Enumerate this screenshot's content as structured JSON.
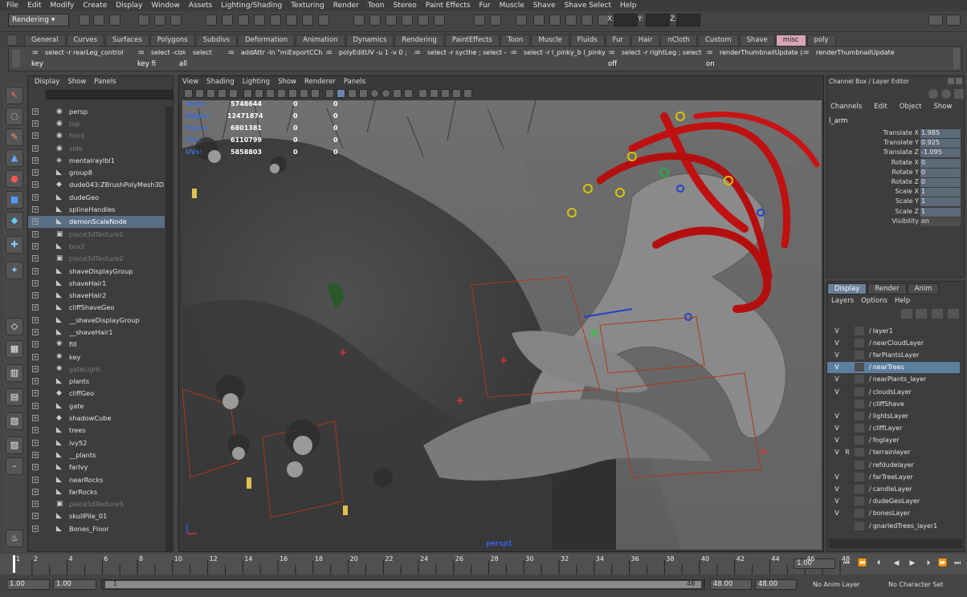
{
  "menubar": [
    "File",
    "Edit",
    "Modify",
    "Create",
    "Display",
    "Window",
    "Assets",
    "Lighting/Shading",
    "Texturing",
    "Render",
    "Toon",
    "Stereo",
    "Paint Effects",
    "Fur",
    "Muscle",
    "Shave",
    "Shave Select",
    "Help"
  ],
  "status": {
    "mode": "Rendering",
    "x_label": "X:",
    "y_label": "Y:",
    "z_label": "Z:"
  },
  "shelf_tabs": [
    "General",
    "Curves",
    "Surfaces",
    "Polygons",
    "Subdivs",
    "Deformation",
    "Animation",
    "Dynamics",
    "Rendering",
    "PaintEffects",
    "Toon",
    "Muscle",
    "Fluids",
    "Fur",
    "Hair",
    "nCloth",
    "Custom",
    "Shave",
    "misc",
    "poly"
  ],
  "shelf_active": "misc",
  "shelf_buttons": [
    {
      "label": "select -r rearLeg_control",
      "sub": "key"
    },
    {
      "label": "select -cl;",
      "sub": "key fi"
    },
    {
      "label": "select",
      "sub": "all"
    },
    {
      "label": "addAttr -ln \"miExportCCh",
      "sub": ""
    },
    {
      "label": "polyEditUV -u 1 -v 0 ;",
      "sub": ""
    },
    {
      "label": "select -r sycthe ; select -",
      "sub": ""
    },
    {
      "label": "select -r l_pinky_b l_pinky",
      "sub": ""
    },
    {
      "label": "select -r rightLeg ; select",
      "sub": "off"
    },
    {
      "label": "renderThumbnailUpdate (",
      "sub": "on"
    },
    {
      "label": "renderThumbnailUpdate",
      "sub": ""
    }
  ],
  "outliner": {
    "menu": [
      "Display",
      "Show",
      "Panels"
    ],
    "items": [
      {
        "name": "persp",
        "dim": false,
        "icon": "camera-icon"
      },
      {
        "name": "top",
        "dim": true,
        "icon": "camera-icon"
      },
      {
        "name": "front",
        "dim": true,
        "icon": "camera-icon"
      },
      {
        "name": "side",
        "dim": true,
        "icon": "camera-icon"
      },
      {
        "name": "mentalrayIbl1",
        "dim": false,
        "icon": "node-icon"
      },
      {
        "name": "group8",
        "dim": false,
        "icon": "transform-icon"
      },
      {
        "name": "dude043:ZBrushPolyMesh3D",
        "dim": false,
        "icon": "mesh-icon"
      },
      {
        "name": "dudeGeo",
        "dim": false,
        "icon": "transform-icon"
      },
      {
        "name": "splineHandles",
        "dim": false,
        "icon": "transform-icon"
      },
      {
        "name": "demonScaleNode",
        "dim": false,
        "icon": "transform-icon",
        "sel": true
      },
      {
        "name": "place3dTexture1",
        "dim": true,
        "icon": "texture-icon"
      },
      {
        "name": "box2",
        "dim": true,
        "icon": "transform-icon"
      },
      {
        "name": "place3dTexture2",
        "dim": true,
        "icon": "texture-icon"
      },
      {
        "name": "shaveDisplayGroup",
        "dim": false,
        "icon": "transform-icon"
      },
      {
        "name": "shaveHair1",
        "dim": false,
        "icon": "transform-icon"
      },
      {
        "name": "shaveHair2",
        "dim": false,
        "icon": "transform-icon"
      },
      {
        "name": "cliffShaveGeo",
        "dim": false,
        "icon": "transform-icon"
      },
      {
        "name": "__shaveDisplayGroup",
        "dim": false,
        "icon": "transform-icon"
      },
      {
        "name": "__shaveHair1",
        "dim": false,
        "icon": "transform-icon"
      },
      {
        "name": "fill",
        "dim": false,
        "icon": "light-icon"
      },
      {
        "name": "key",
        "dim": false,
        "icon": "light-icon"
      },
      {
        "name": "gateLight",
        "dim": true,
        "icon": "light-icon"
      },
      {
        "name": "plants",
        "dim": false,
        "icon": "transform-icon"
      },
      {
        "name": "cliffGeo",
        "dim": false,
        "icon": "mesh-icon"
      },
      {
        "name": "gate",
        "dim": false,
        "icon": "transform-icon"
      },
      {
        "name": "shadowCube",
        "dim": false,
        "icon": "mesh-icon"
      },
      {
        "name": "trees",
        "dim": false,
        "icon": "transform-icon"
      },
      {
        "name": "ivy52",
        "dim": false,
        "icon": "transform-icon"
      },
      {
        "name": "__plants",
        "dim": false,
        "icon": "transform-icon"
      },
      {
        "name": "farIvy",
        "dim": false,
        "icon": "transform-icon"
      },
      {
        "name": "nearRocks",
        "dim": false,
        "icon": "transform-icon"
      },
      {
        "name": "farRocks",
        "dim": false,
        "icon": "transform-icon"
      },
      {
        "name": "place3dTexture3",
        "dim": true,
        "icon": "texture-icon"
      },
      {
        "name": "skullPile_01",
        "dim": false,
        "icon": "transform-icon"
      },
      {
        "name": "Bones_Floor",
        "dim": false,
        "icon": "transform-icon"
      }
    ]
  },
  "viewport": {
    "menu": [
      "View",
      "Shading",
      "Lighting",
      "Show",
      "Renderer",
      "Panels"
    ],
    "hud": [
      {
        "label": "Verts:",
        "v1": "5748644",
        "v2": "0",
        "v3": "0"
      },
      {
        "label": "Edges:",
        "v1": "12471874",
        "v2": "0",
        "v3": "0"
      },
      {
        "label": "Faces:",
        "v1": "6801381",
        "v2": "0",
        "v3": "0"
      },
      {
        "label": "Tris:",
        "v1": "6110799",
        "v2": "0",
        "v3": "0"
      },
      {
        "label": "UVs:",
        "v1": "5858803",
        "v2": "0",
        "v3": "0"
      }
    ],
    "camera": "persp1"
  },
  "channelbox": {
    "title": "Channel Box / Layer Editor",
    "menu": [
      "Channels",
      "Edit",
      "Object",
      "Show"
    ],
    "object": "l_arm",
    "attrs": [
      {
        "name": "Translate X",
        "value": "1.985",
        "white": false
      },
      {
        "name": "Translate Y",
        "value": "0.925",
        "white": false
      },
      {
        "name": "Translate Z",
        "value": "-1.095",
        "white": false
      },
      {
        "name": "Rotate X",
        "value": "0",
        "white": false
      },
      {
        "name": "Rotate Y",
        "value": "0",
        "white": false
      },
      {
        "name": "Rotate Z",
        "value": "0",
        "white": false
      },
      {
        "name": "Scale X",
        "value": "1",
        "white": false
      },
      {
        "name": "Scale Y",
        "value": "1",
        "white": false
      },
      {
        "name": "Scale Z",
        "value": "1",
        "white": false
      },
      {
        "name": "Visibility",
        "value": "on",
        "white": true
      }
    ]
  },
  "layers": {
    "tabs": [
      "Display",
      "Render",
      "Anim"
    ],
    "menu": [
      "Layers",
      "Options",
      "Help"
    ],
    "items": [
      {
        "v": "V",
        "r": "",
        "name": "layer1"
      },
      {
        "v": "V",
        "r": "",
        "name": "nearCloudLayer"
      },
      {
        "v": "V",
        "r": "",
        "name": "farPlantsLayer"
      },
      {
        "v": "V",
        "r": "",
        "name": "nearTrees",
        "sel": true
      },
      {
        "v": "V",
        "r": "",
        "name": "nearPlants_layer"
      },
      {
        "v": "V",
        "r": "",
        "name": "cloudsLayer"
      },
      {
        "v": "",
        "r": "",
        "name": "cliffShave"
      },
      {
        "v": "V",
        "r": "",
        "name": "lightsLayer"
      },
      {
        "v": "V",
        "r": "",
        "name": "cliffLayer"
      },
      {
        "v": "V",
        "r": "",
        "name": "foglayer"
      },
      {
        "v": "V",
        "r": "R",
        "name": "terrainlayer"
      },
      {
        "v": "",
        "r": "",
        "name": "refdudelayer"
      },
      {
        "v": "V",
        "r": "",
        "name": "farTreeLayer"
      },
      {
        "v": "V",
        "r": "",
        "name": "candleLayer"
      },
      {
        "v": "V",
        "r": "",
        "name": "dudeGeoLayer"
      },
      {
        "v": "V",
        "r": "",
        "name": "bonesLayer"
      },
      {
        "v": "",
        "r": "",
        "name": "gnarledTrees_layer1"
      }
    ]
  },
  "timeline": {
    "ticks": [
      "1",
      "2",
      "4",
      "6",
      "8",
      "10",
      "12",
      "14",
      "16",
      "18",
      "20",
      "22",
      "24",
      "26",
      "28",
      "30",
      "32",
      "34",
      "36",
      "38",
      "40",
      "42",
      "44",
      "46",
      "48"
    ],
    "current": "1.00"
  },
  "range": {
    "start": "1.00",
    "start2": "1.00",
    "inner_start": "1",
    "inner_end": "48",
    "end": "48.00",
    "end2": "48.00",
    "anim_layer": "No Anim Layer",
    "char_set": "No Character Set"
  }
}
